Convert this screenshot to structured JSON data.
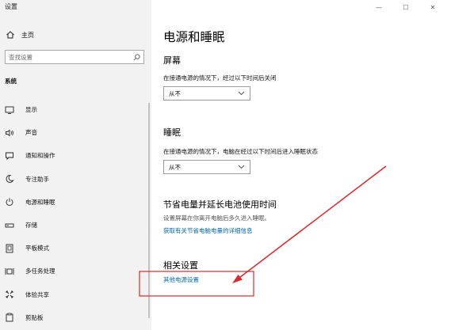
{
  "window": {
    "title": "设置",
    "controls": [
      "—",
      "☐",
      "✕"
    ]
  },
  "sidebar": {
    "home_label": "主页",
    "search_placeholder": "查找设置",
    "section_title": "系统",
    "items": [
      {
        "label": "显示",
        "icon": "monitor-icon"
      },
      {
        "label": "声音",
        "icon": "speaker-icon"
      },
      {
        "label": "通知和操作",
        "icon": "notification-icon"
      },
      {
        "label": "专注助手",
        "icon": "moon-icon"
      },
      {
        "label": "电源和睡眠",
        "icon": "power-icon"
      },
      {
        "label": "存储",
        "icon": "storage-icon"
      },
      {
        "label": "平板模式",
        "icon": "tablet-icon"
      },
      {
        "label": "多任务处理",
        "icon": "multitask-icon"
      },
      {
        "label": "体验共享",
        "icon": "share-icon"
      },
      {
        "label": "剪贴板",
        "icon": "clipboard-icon"
      }
    ]
  },
  "main": {
    "title": "电源和睡眠",
    "screen": {
      "heading": "屏幕",
      "label": "在接通电源的情况下，经过以下时间后关闭",
      "value": "从不"
    },
    "sleep": {
      "heading": "睡眠",
      "label": "在接通电源的情况下，电脑在经过以下时间后进入睡眠状态",
      "value": "从不"
    },
    "battery": {
      "heading": "节省电量并延长电池使用时间",
      "desc": "设置屏幕在你离开电脑后多久进入睡眠。",
      "link": "获取有关节省电脑电量的详细信息"
    },
    "related": {
      "heading": "相关设置",
      "link": "其他电源设置"
    }
  },
  "annotation": {
    "color": "#e0272b"
  }
}
